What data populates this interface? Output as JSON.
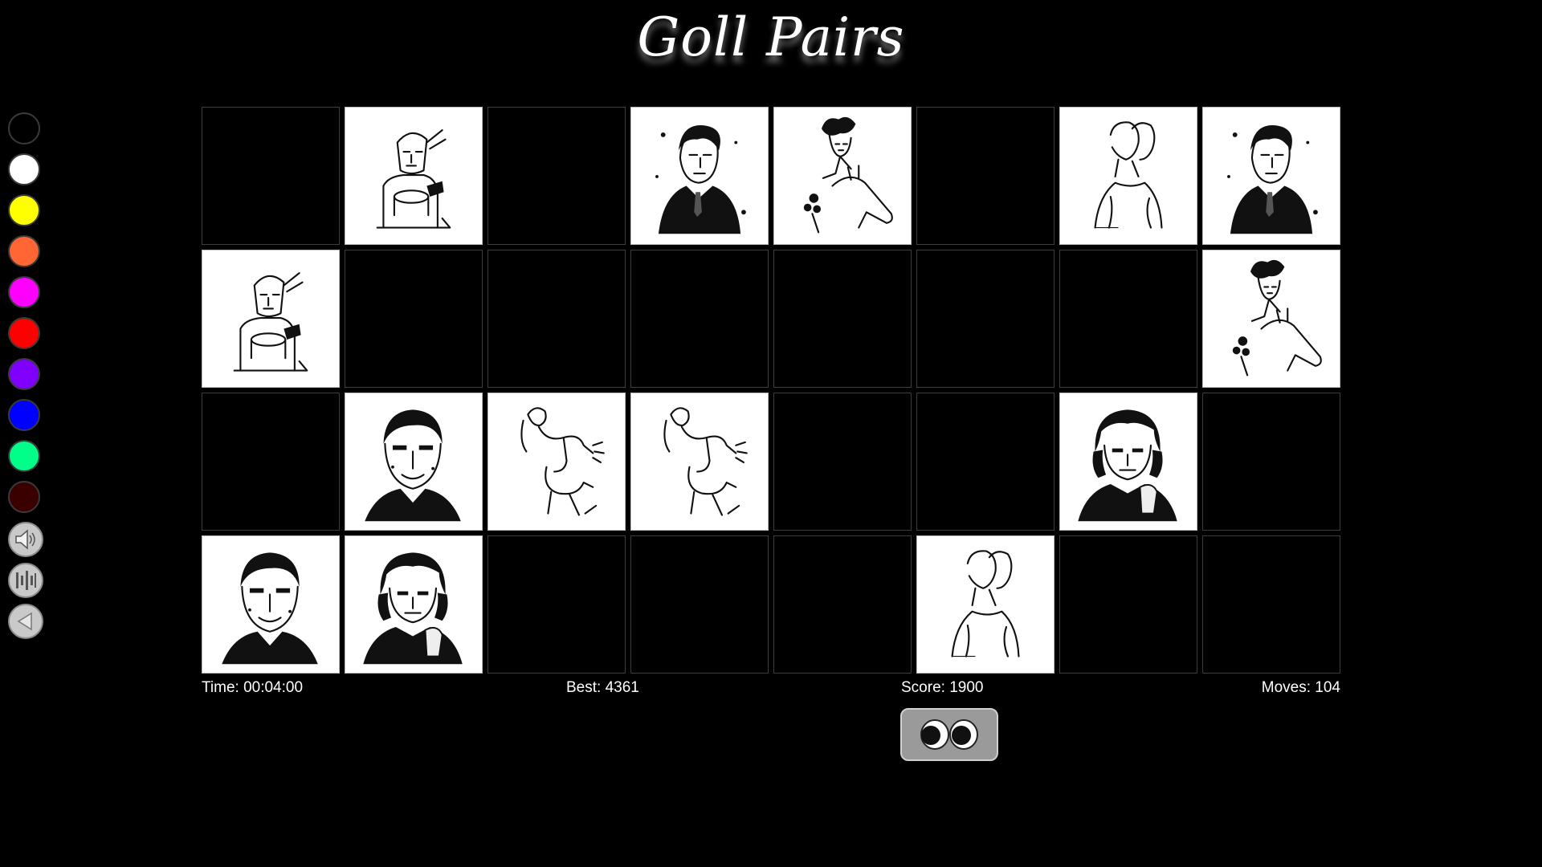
{
  "title": "Goll Pairs",
  "palette": [
    "#000000",
    "#ffffff",
    "#ffff00",
    "#ff6633",
    "#ff00ff",
    "#ff0000",
    "#7f00ff",
    "#0000ff",
    "#00ff88",
    "#3a0000"
  ],
  "tools": [
    "speaker-icon",
    "equalizer-icon",
    "back-arrow-icon"
  ],
  "board": [
    [
      "hidden",
      "jester",
      "hidden",
      "man-tie",
      "lady-horse",
      "hidden",
      "two-profiles",
      "man-tie"
    ],
    [
      "jester",
      "hidden",
      "hidden",
      "hidden",
      "hidden",
      "hidden",
      "hidden",
      "lady-horse"
    ],
    [
      "hidden",
      "man-smile",
      "dancers",
      "dancers",
      "hidden",
      "hidden",
      "woman-hand",
      "hidden"
    ],
    [
      "man-smile",
      "woman-hand",
      "hidden",
      "hidden",
      "hidden",
      "two-profiles",
      "hidden",
      "hidden"
    ]
  ],
  "stats": {
    "time": "Time: 00:04:00",
    "best": "Best: 4361",
    "score": "Score: 1900",
    "moves": "Moves: 104"
  }
}
